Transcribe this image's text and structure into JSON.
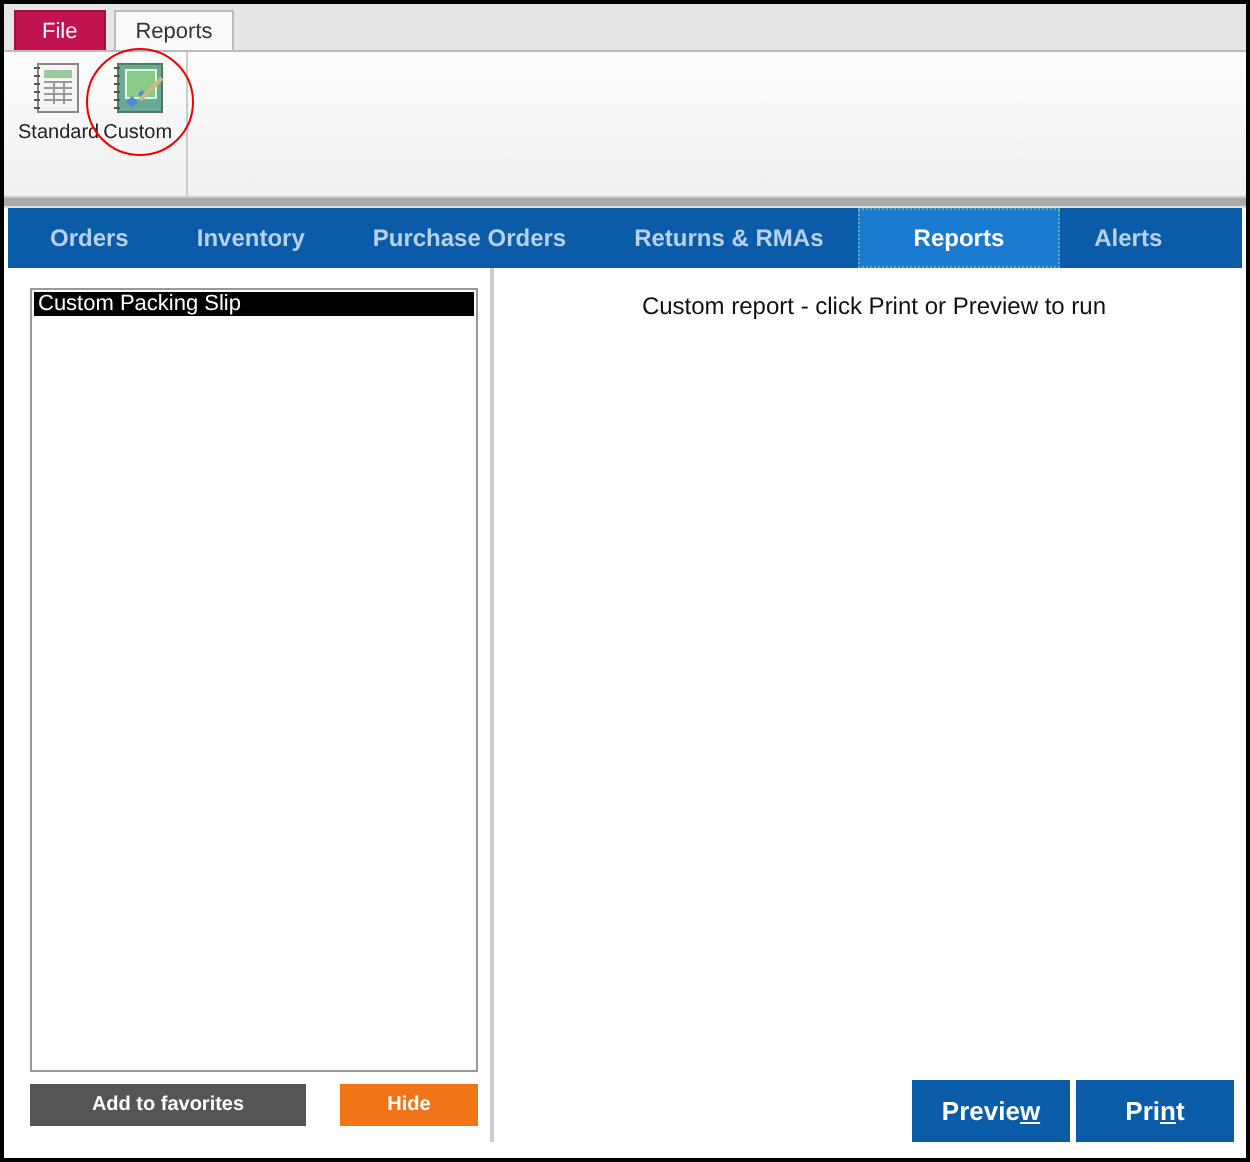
{
  "ribbon_tabs": [
    {
      "label": "File",
      "kind": "file",
      "selected": false
    },
    {
      "label": "Reports",
      "kind": "tab",
      "selected": true
    }
  ],
  "ribbon_buttons": [
    {
      "label": "Standard",
      "kind": "standard",
      "highlighted": false
    },
    {
      "label": "Custom",
      "kind": "custom",
      "highlighted": true
    }
  ],
  "nav_tabs": [
    {
      "label": "Orders",
      "selected": false
    },
    {
      "label": "Inventory",
      "selected": false
    },
    {
      "label": "Purchase Orders",
      "selected": false
    },
    {
      "label": "Returns & RMAs",
      "selected": false
    },
    {
      "label": "Reports",
      "selected": true
    },
    {
      "label": "Alerts",
      "selected": false
    }
  ],
  "report_list": {
    "items": [
      {
        "label": "Custom Packing Slip",
        "selected": true
      }
    ]
  },
  "list_buttons": [
    {
      "label": "Add to favorites",
      "kind": "dark"
    },
    {
      "label": "Hide",
      "kind": "orange"
    }
  ],
  "message": "Custom report - click Print or Preview to run",
  "action_buttons": [
    {
      "before": "Previe",
      "access_key": "w"
    },
    {
      "before": "Pri",
      "access_key": "n",
      "after": "t"
    }
  ]
}
